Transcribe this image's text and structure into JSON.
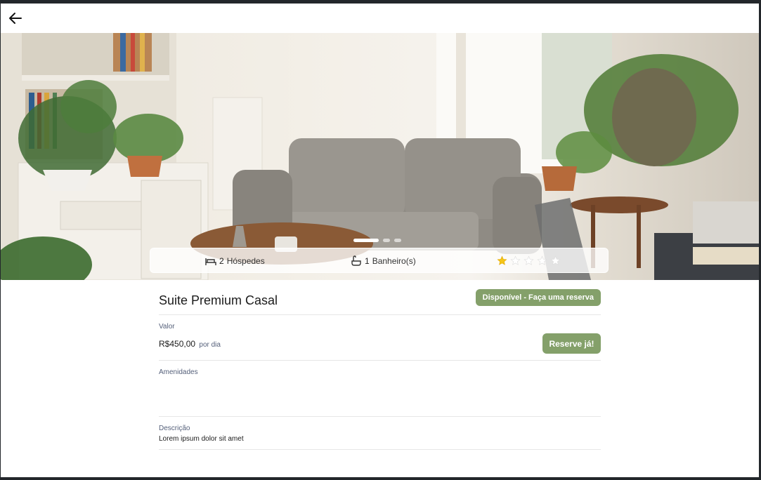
{
  "hero": {
    "carousel": {
      "count": 3,
      "active_index": 0
    },
    "guests": {
      "count": "2",
      "label": "Hóspedes"
    },
    "bathrooms": {
      "count": "1",
      "label": "Banheiro(s)"
    },
    "rating": {
      "value": 1,
      "max": 5,
      "filled_color": "#f5c518",
      "empty_color": "#ffffff"
    }
  },
  "room": {
    "title": "Suite Premium Casal",
    "status": "Disponível - Faça uma reserva"
  },
  "pricing": {
    "label": "Valor",
    "price": "R$450,00",
    "per": "por dia",
    "reserve_button": "Reserve já!"
  },
  "amenities": {
    "label": "Amenidades"
  },
  "description": {
    "label": "Descrição",
    "text": "Lorem ipsum dolor sit amet"
  },
  "colors": {
    "accent": "#84a06a"
  }
}
